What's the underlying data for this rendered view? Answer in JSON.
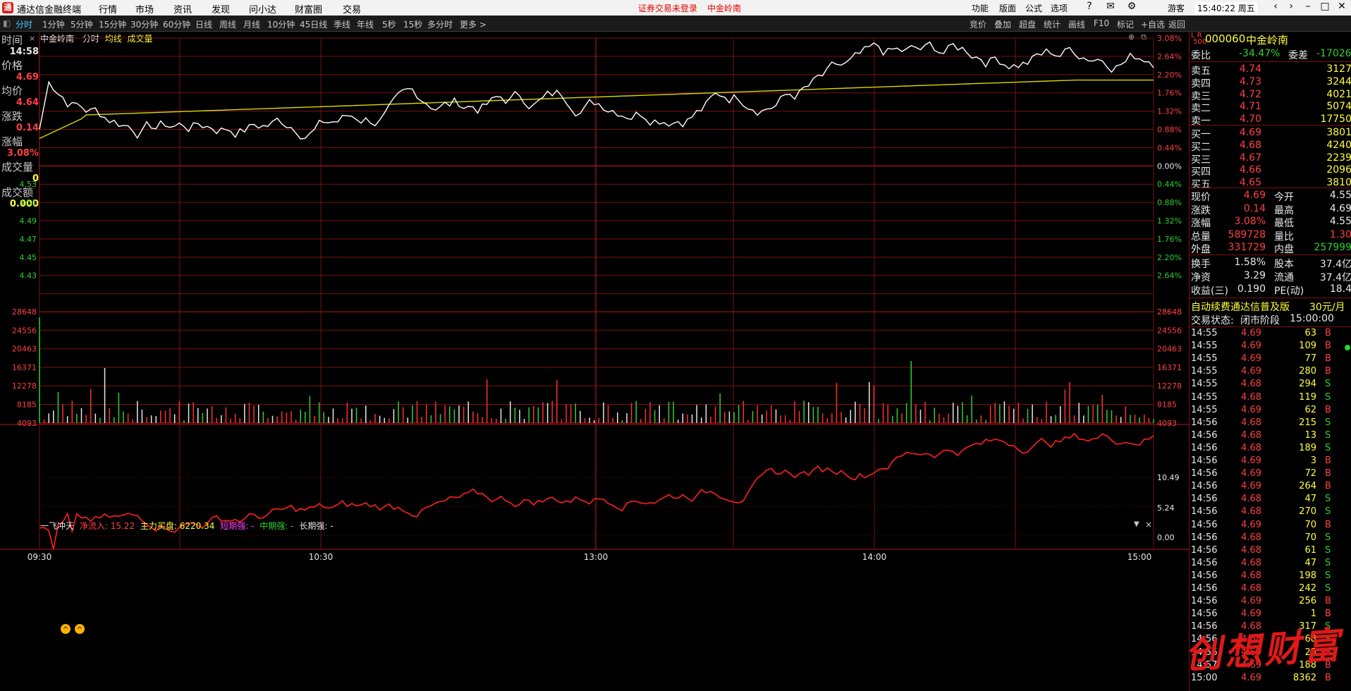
{
  "titlebar": {
    "app_name": "通达信金融终端",
    "menus": [
      "行情",
      "市场",
      "资讯",
      "发现",
      "问小达",
      "财富圈",
      "交易"
    ],
    "center_notice": "证券交易未登录",
    "center_stock": "中金岭南",
    "right_menus": [
      "功能",
      "版面",
      "公式",
      "选项"
    ],
    "user": "游客",
    "clock": "15:40:22 周五"
  },
  "periodbar": {
    "periods": [
      "分时",
      "1分钟",
      "5分钟",
      "15分钟",
      "30分钟",
      "60分钟",
      "日线",
      "周线",
      "月线",
      "10分钟",
      "45日线",
      "季线",
      "年线",
      "5秒",
      "15秒",
      "多分时",
      "更多 >"
    ],
    "active": "分时",
    "right_buttons": [
      "竞价",
      "叠加",
      "超盘",
      "统计",
      "画线",
      "F10",
      "标记",
      "+自选",
      "返回"
    ]
  },
  "chart_header": {
    "stock_name": "中金岭南",
    "mode": "分时",
    "avg_line": "均线",
    "volume": "成交量"
  },
  "left_info": {
    "time_label": "时间",
    "time_value": "14:58",
    "price_label": "价格",
    "price_value": "4.69",
    "avg_label": "均价",
    "avg_value": "4.64",
    "change_label": "涨跌",
    "change_value": "0.14",
    "pct_label": "涨幅",
    "pct_value": "3.08%",
    "vol_label": "成交量",
    "vol_value": "0",
    "amt_label": "成交额",
    "amt_value": "0.000"
  },
  "price_axis": {
    "left": [
      "4.53",
      "4.51",
      "4.49",
      "4.47",
      "4.45",
      "4.43"
    ],
    "right_up": [
      "3.08%",
      "2.64%",
      "2.20%",
      "1.76%",
      "1.32%",
      "0.88%",
      "0.44%",
      "0.00%"
    ],
    "right_down": [
      "0.44%",
      "0.88%",
      "1.32%",
      "1.76%",
      "2.20%",
      "2.64%"
    ]
  },
  "volume_axis": [
    "28648",
    "24556",
    "20463",
    "16371",
    "12278",
    "8185",
    "4093"
  ],
  "indicator": {
    "name": "一飞冲天",
    "net_inflow_label": "净流入:",
    "net_inflow_value": "15.22",
    "main_label": "主力买盘:",
    "main_value": "6220.34",
    "short_label": "短期强:",
    "short_value": "-",
    "mid_label": "中期强:",
    "mid_value": "-",
    "long_label": "长期强:",
    "long_value": "-",
    "axis": [
      "10.49",
      "5.24",
      "0.00"
    ]
  },
  "time_axis": [
    "09:30",
    "10:30",
    "13:00",
    "14:00",
    "15:00"
  ],
  "quote_panel": {
    "code": "000060",
    "name": "中金岭南",
    "ratio_label": "委比",
    "ratio_value": "-34.47%",
    "diff_label": "委差",
    "diff_value": "-17026",
    "asks": [
      {
        "label": "卖五",
        "price": "4.74",
        "vol": "3127"
      },
      {
        "label": "卖四",
        "price": "4.73",
        "vol": "3244"
      },
      {
        "label": "卖三",
        "price": "4.72",
        "vol": "4021"
      },
      {
        "label": "卖二",
        "price": "4.71",
        "vol": "5074"
      },
      {
        "label": "卖一",
        "price": "4.70",
        "vol": "17750"
      }
    ],
    "bids": [
      {
        "label": "买一",
        "price": "4.69",
        "vol": "3801"
      },
      {
        "label": "买二",
        "price": "4.68",
        "vol": "4240"
      },
      {
        "label": "买三",
        "price": "4.67",
        "vol": "2239"
      },
      {
        "label": "买四",
        "price": "4.66",
        "vol": "2096"
      },
      {
        "label": "买五",
        "price": "4.65",
        "vol": "3810"
      }
    ],
    "stats": [
      {
        "l1": "现价",
        "v1": "4.69",
        "l2": "今开",
        "v2": "4.55"
      },
      {
        "l1": "涨跌",
        "v1": "0.14",
        "l2": "最高",
        "v2": "4.69"
      },
      {
        "l1": "涨幅",
        "v1": "3.08%",
        "l2": "最低",
        "v2": "4.55"
      },
      {
        "l1": "总量",
        "v1": "589728",
        "l2": "量比",
        "v2": "1.30"
      },
      {
        "l1": "外盘",
        "v1": "331729",
        "l2": "内盘",
        "v2": "257999"
      }
    ],
    "stats2": [
      {
        "l1": "换手",
        "v1": "1.58%",
        "l2": "股本",
        "v2": "37.4亿"
      },
      {
        "l1": "净资",
        "v1": "3.29",
        "l2": "流通",
        "v2": "37.4亿"
      },
      {
        "l1": "收益(三)",
        "v1": "0.190",
        "l2": "PE(动)",
        "v2": "18.4"
      }
    ],
    "promo": "自动续费通达信普及版",
    "promo_price": "30元/月",
    "status_label": "交易状态:",
    "status_value": "闭市阶段",
    "status_time": "15:00:00",
    "ticks": [
      {
        "t": "14:55",
        "p": "4.69",
        "v": "63",
        "d": "B"
      },
      {
        "t": "14:55",
        "p": "4.69",
        "v": "109",
        "d": "B"
      },
      {
        "t": "14:55",
        "p": "4.69",
        "v": "77",
        "d": "B"
      },
      {
        "t": "14:55",
        "p": "4.69",
        "v": "280",
        "d": "B"
      },
      {
        "t": "14:55",
        "p": "4.68",
        "v": "294",
        "d": "S"
      },
      {
        "t": "14:55",
        "p": "4.68",
        "v": "119",
        "d": "S"
      },
      {
        "t": "14:55",
        "p": "4.69",
        "v": "62",
        "d": "B"
      },
      {
        "t": "14:56",
        "p": "4.68",
        "v": "215",
        "d": "S"
      },
      {
        "t": "14:56",
        "p": "4.68",
        "v": "13",
        "d": "S"
      },
      {
        "t": "14:56",
        "p": "4.68",
        "v": "189",
        "d": "S"
      },
      {
        "t": "14:56",
        "p": "4.69",
        "v": "3",
        "d": "B"
      },
      {
        "t": "14:56",
        "p": "4.69",
        "v": "72",
        "d": "B"
      },
      {
        "t": "14:56",
        "p": "4.69",
        "v": "264",
        "d": "B"
      },
      {
        "t": "14:56",
        "p": "4.68",
        "v": "47",
        "d": "S"
      },
      {
        "t": "14:56",
        "p": "4.68",
        "v": "270",
        "d": "S"
      },
      {
        "t": "14:56",
        "p": "4.69",
        "v": "70",
        "d": "B"
      },
      {
        "t": "14:56",
        "p": "4.68",
        "v": "70",
        "d": "S"
      },
      {
        "t": "14:56",
        "p": "4.68",
        "v": "61",
        "d": "S"
      },
      {
        "t": "14:56",
        "p": "4.68",
        "v": "47",
        "d": "S"
      },
      {
        "t": "14:56",
        "p": "4.68",
        "v": "198",
        "d": "S"
      },
      {
        "t": "14:56",
        "p": "4.68",
        "v": "242",
        "d": "S"
      },
      {
        "t": "14:56",
        "p": "4.69",
        "v": "256",
        "d": "B"
      },
      {
        "t": "14:56",
        "p": "4.69",
        "v": "1",
        "d": "B"
      },
      {
        "t": "14:56",
        "p": "4.68",
        "v": "317",
        "d": "S"
      },
      {
        "t": "14:56",
        "p": "4.68",
        "v": "68",
        "d": "S"
      },
      {
        "t": "14:56",
        "p": "4.69",
        "v": "25",
        "d": "B"
      },
      {
        "t": "14:57",
        "p": "4.69",
        "v": "188",
        "d": "B"
      },
      {
        "t": "15:00",
        "p": "4.69",
        "v": "8362",
        "d": "B"
      }
    ]
  },
  "watermark": "创想财富",
  "colors": {
    "up": "#ff4040",
    "down": "#2fd02f",
    "price_line": "#ffffff",
    "avg_line": "#d9d900",
    "grid": "#7a1010"
  }
}
